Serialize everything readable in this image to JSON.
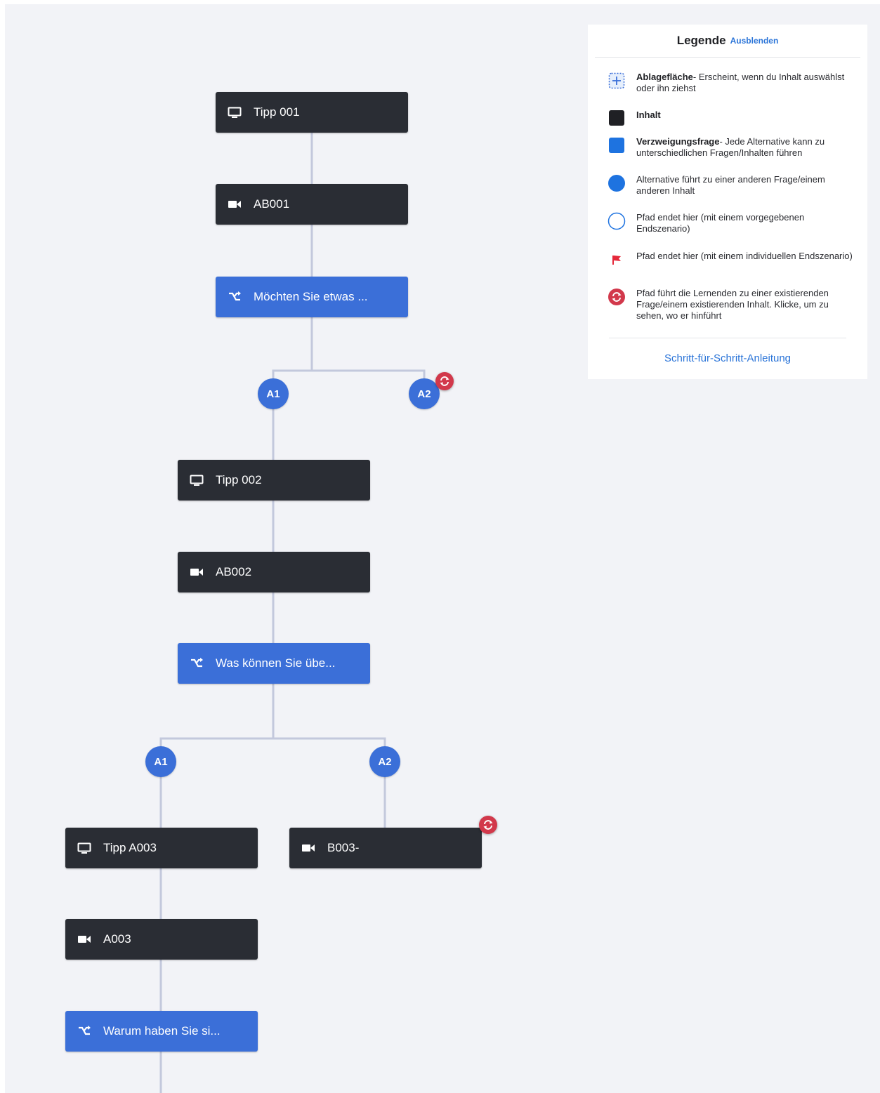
{
  "nodes": {
    "n1": {
      "label": "Tipp 001",
      "icon": "monitor-icon"
    },
    "n2": {
      "label": "AB001",
      "icon": "video-camera-icon"
    },
    "n3": {
      "label": "Möchten Sie etwas ...",
      "icon": "branch-icon"
    },
    "n4": {
      "label": "Tipp 002",
      "icon": "monitor-icon"
    },
    "n5": {
      "label": "AB002",
      "icon": "video-camera-icon"
    },
    "n6": {
      "label": "Was können Sie übe...",
      "icon": "branch-icon"
    },
    "n7": {
      "label": "Tipp A003",
      "icon": "monitor-icon"
    },
    "n8": {
      "label": "B003-",
      "icon": "video-camera-icon"
    },
    "n9": {
      "label": "A003",
      "icon": "video-camera-icon"
    },
    "n10": {
      "label": "Warum haben Sie si...",
      "icon": "branch-icon"
    }
  },
  "alternatives": {
    "q1a1": "A1",
    "q1a2": "A2",
    "q2a1": "A1",
    "q2a2": "A2"
  },
  "legend": {
    "title": "Legende",
    "hide_label": "Ausblenden",
    "drop_zone_bold": "Ablagefläche",
    "drop_zone_text": "- Erscheint, wenn du Inhalt auswählst oder ihn ziehst",
    "content_bold": "Inhalt",
    "branch_bold": "Verzweigungsfrage",
    "branch_text": "- Jede Alternative kann zu unterschiedlichen Fragen/Inhalten führen",
    "alternative_text": "Alternative führt zu einer anderen Frage/einem anderen Inhalt",
    "path_end_preset_text": "Pfad endet hier (mit einem vorgegebenen Endszenario)",
    "path_end_custom_text": "Pfad endet hier (mit einem individuellen Endszenario)",
    "loop_text": "Pfad führt die Lernenden zu einer existierenden Frage/einem existierenden Inhalt. Klicke, um zu sehen, wo er hinführt",
    "guide_link": "Schritt-für-Schritt-Anleitung"
  },
  "colors": {
    "content": "#2a2d34",
    "question": "#3b6fd8",
    "connector": "#c3c8dc",
    "loop": "#d2384b",
    "link": "#2a74d8",
    "flag": "#e5283a"
  }
}
